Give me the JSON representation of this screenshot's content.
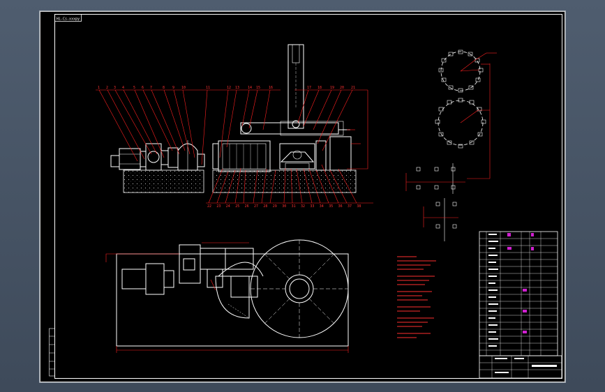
{
  "drawing_tag": "Hi-Cs-xxxpy",
  "colors": {
    "background": "#000000",
    "frame": "#ffffff",
    "leader": "#ff2020",
    "annotation": "#ff3030",
    "highlight": "#d020d0"
  },
  "callouts_top": [
    "1",
    "2",
    "3",
    "4",
    "5",
    "6",
    "7",
    "8",
    "9",
    "10",
    "11",
    "12",
    "13",
    "14",
    "15",
    "16",
    "17",
    "18",
    "19",
    "20",
    "21"
  ],
  "callouts_bottom": [
    "22",
    "23",
    "24",
    "25",
    "26",
    "27",
    "28",
    "29",
    "30",
    "31",
    "32",
    "33",
    "34",
    "35",
    "36",
    "37",
    "38"
  ]
}
